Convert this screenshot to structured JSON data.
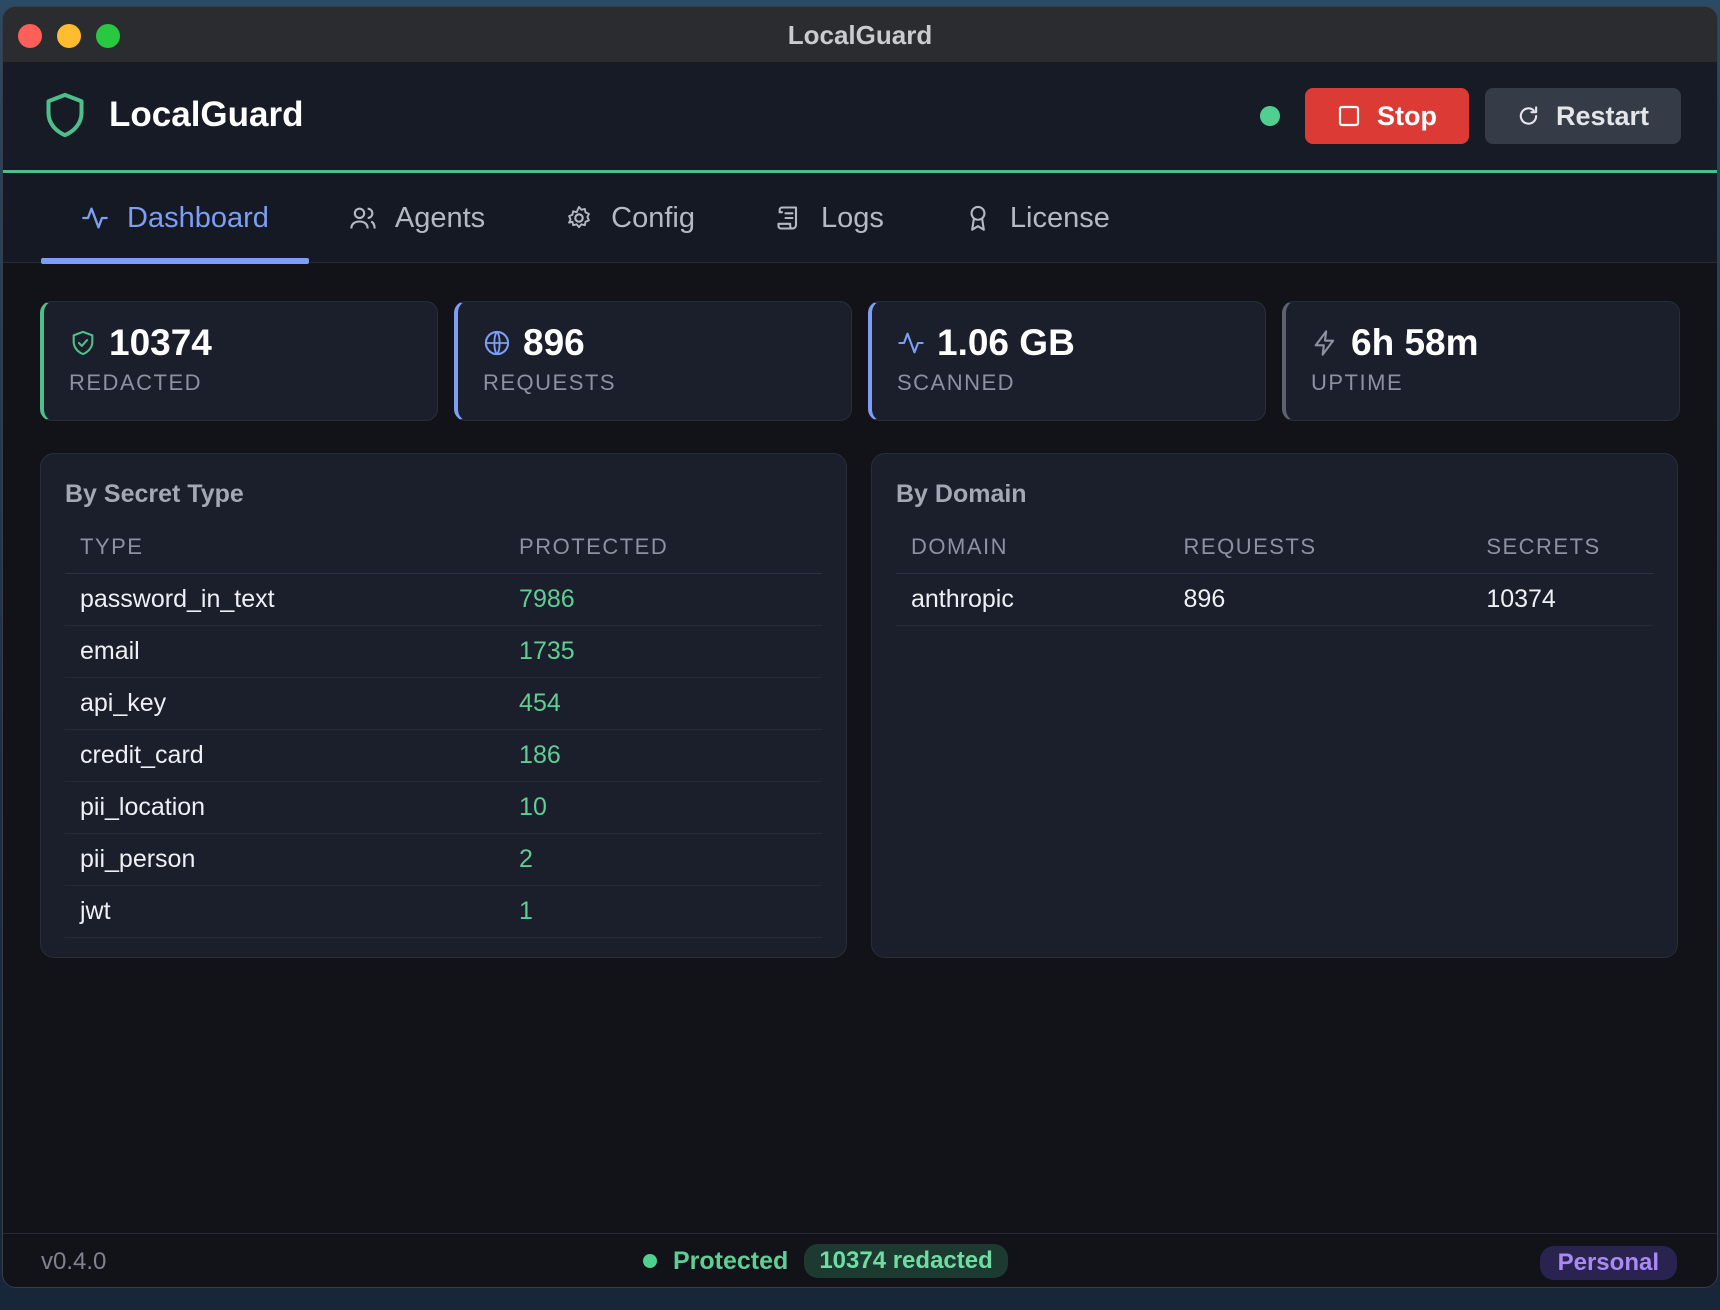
{
  "window": {
    "title": "LocalGuard"
  },
  "header": {
    "brand_name": "LocalGuard",
    "stop_label": "Stop",
    "restart_label": "Restart"
  },
  "tabs": [
    {
      "label": "Dashboard",
      "icon": "activity-icon",
      "active": true
    },
    {
      "label": "Agents",
      "icon": "users-icon"
    },
    {
      "label": "Config",
      "icon": "gear-icon"
    },
    {
      "label": "Logs",
      "icon": "scroll-icon"
    },
    {
      "label": "License",
      "icon": "award-icon"
    }
  ],
  "stats": [
    {
      "value": "10374",
      "label": "REDACTED",
      "icon": "shield-check-icon"
    },
    {
      "value": "896",
      "label": "REQUESTS",
      "icon": "globe-icon"
    },
    {
      "value": "1.06 GB",
      "label": "SCANNED",
      "icon": "activity-icon"
    },
    {
      "value": "6h 58m",
      "label": "UPTIME",
      "icon": "zap-icon"
    }
  ],
  "secret_types": {
    "title": "By Secret Type",
    "columns": [
      "TYPE",
      "PROTECTED"
    ],
    "rows": [
      [
        "password_in_text",
        "7986"
      ],
      [
        "email",
        "1735"
      ],
      [
        "api_key",
        "454"
      ],
      [
        "credit_card",
        "186"
      ],
      [
        "pii_location",
        "10"
      ],
      [
        "pii_person",
        "2"
      ],
      [
        "jwt",
        "1"
      ]
    ]
  },
  "domains": {
    "title": "By Domain",
    "columns": [
      "DOMAIN",
      "REQUESTS",
      "SECRETS"
    ],
    "rows": [
      [
        "anthropic",
        "896",
        "10374"
      ]
    ]
  },
  "footer": {
    "version": "v0.4.0",
    "status": "Protected",
    "redacted_badge": "10374 redacted",
    "plan": "Personal"
  },
  "colors": {
    "accent_green": "#4fbf8a",
    "accent_blue": "#7c9ff5",
    "stop_red": "#dc3b35",
    "plan_purple": "#a98af4"
  }
}
